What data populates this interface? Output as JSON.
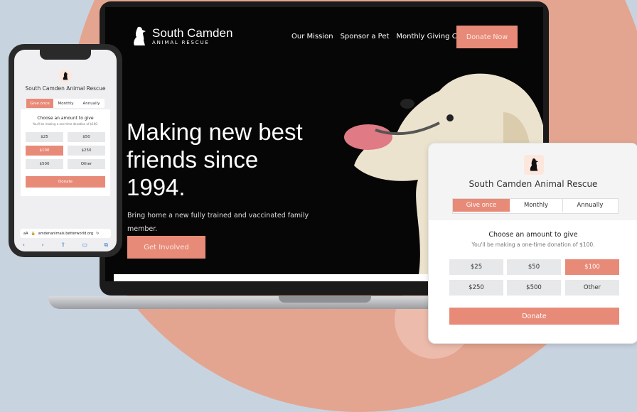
{
  "laptop": {
    "brand_name": "South Camden",
    "brand_sub": "ANIMAL RESCUE",
    "nav": [
      "Our Mission",
      "Sponsor a Pet",
      "Monthly Giving Club"
    ],
    "donate_now": "Donate Now",
    "hero_lines": [
      "Making new best",
      "friends since",
      "1994."
    ],
    "sub_lines": [
      "Bring home a new fully trained and vaccinated family",
      "member."
    ],
    "cta": "Get Involved"
  },
  "phone": {
    "title": "South Camden Animal Rescue",
    "tabs": [
      "Give once",
      "Monthly",
      "Annually"
    ],
    "heading": "Choose an amount to give",
    "note": "You'll be making a one-time donation of $100.",
    "amounts": [
      "$25",
      "$50",
      "$100",
      "$250",
      "$500",
      "Other"
    ],
    "donate": "Donate",
    "aa": "aA",
    "url": "amdenanimals.betterworld.org"
  },
  "widget": {
    "title": "South Camden Animal Rescue",
    "tabs": [
      "Give once",
      "Monthly",
      "Annually"
    ],
    "heading": "Choose an amount to give",
    "note": "You'll be making a one-time donation of $100.",
    "amounts": [
      "$25",
      "$50",
      "$100",
      "$250",
      "$500",
      "Other"
    ],
    "donate": "Donate"
  },
  "colors": {
    "accent": "#e88a78",
    "blob": "#e3a590",
    "background": "#c8d3e0"
  }
}
